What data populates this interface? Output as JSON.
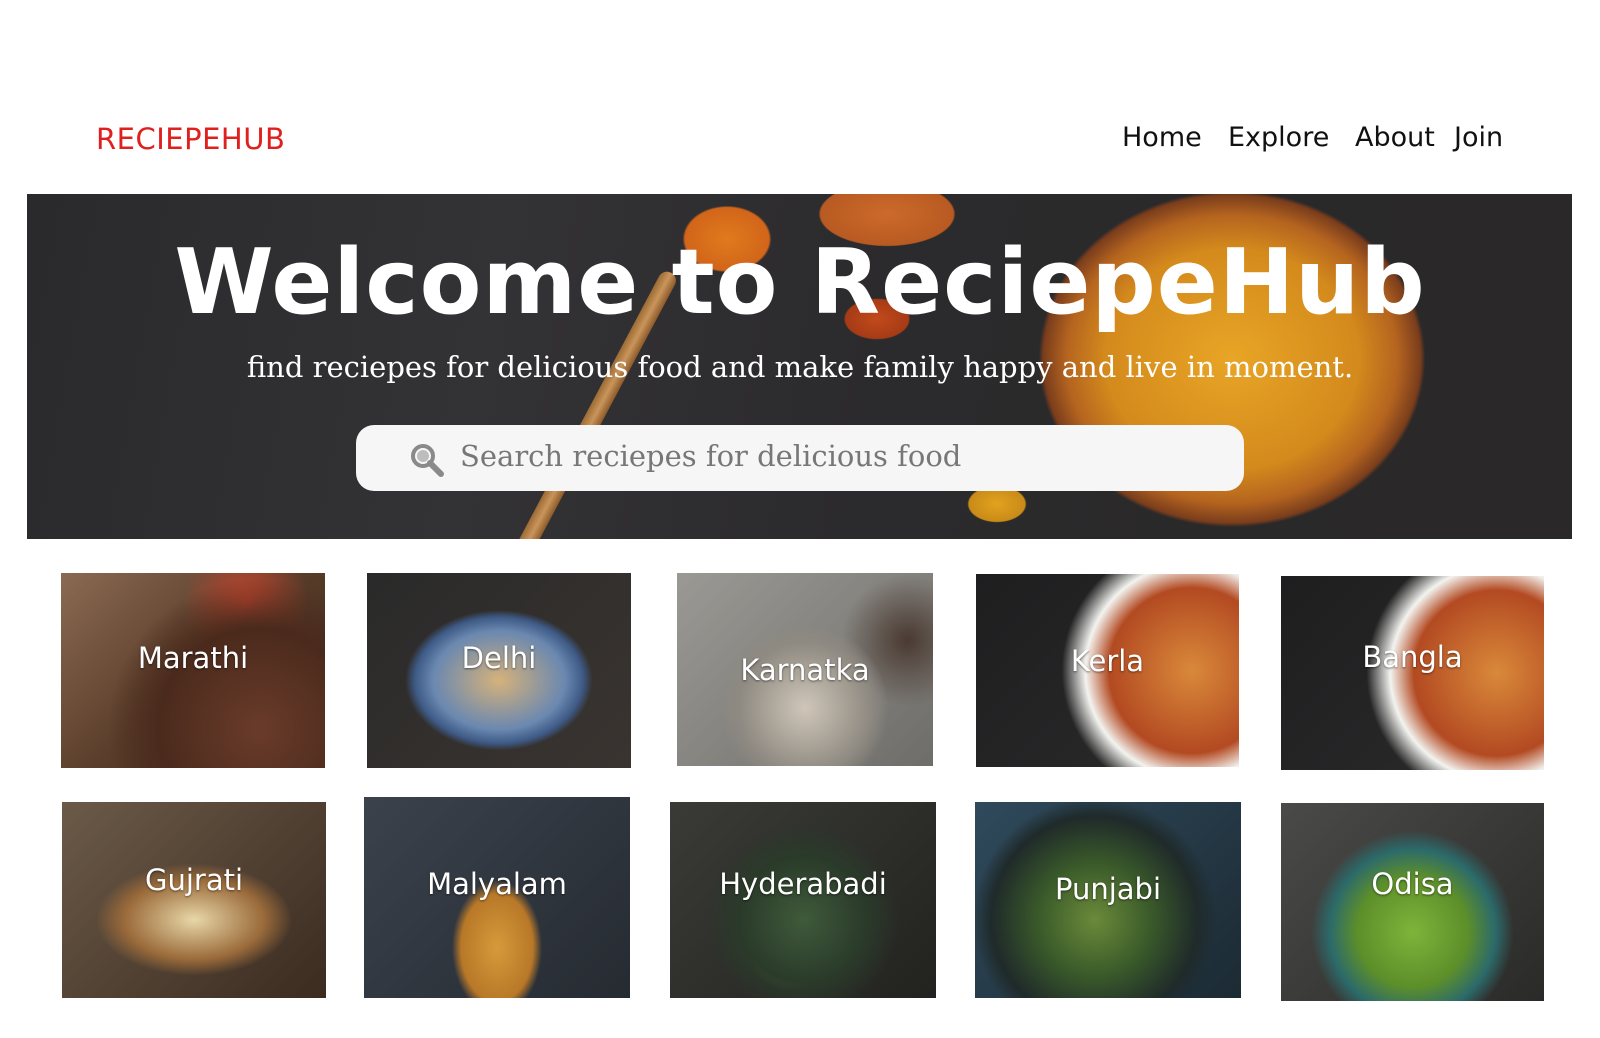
{
  "header": {
    "logo": "RECIEPEHUB",
    "nav": [
      "Home",
      "Explore",
      "About",
      "Join"
    ]
  },
  "hero": {
    "title": "Welcome to ReciepeHub",
    "subtitle": "find reciepes for delicious food and make family happy and live in moment.",
    "search": {
      "placeholder": "Search reciepes for delicious food"
    }
  },
  "cards": [
    {
      "label": "Marathi"
    },
    {
      "label": "Delhi"
    },
    {
      "label": "Karnatka"
    },
    {
      "label": "Kerla"
    },
    {
      "label": "Bangla"
    },
    {
      "label": "Gujrati"
    },
    {
      "label": "Malyalam"
    },
    {
      "label": "Hyderabadi"
    },
    {
      "label": "Punjabi"
    },
    {
      "label": "Odisa"
    }
  ],
  "colors": {
    "brand": "#e0201d"
  }
}
